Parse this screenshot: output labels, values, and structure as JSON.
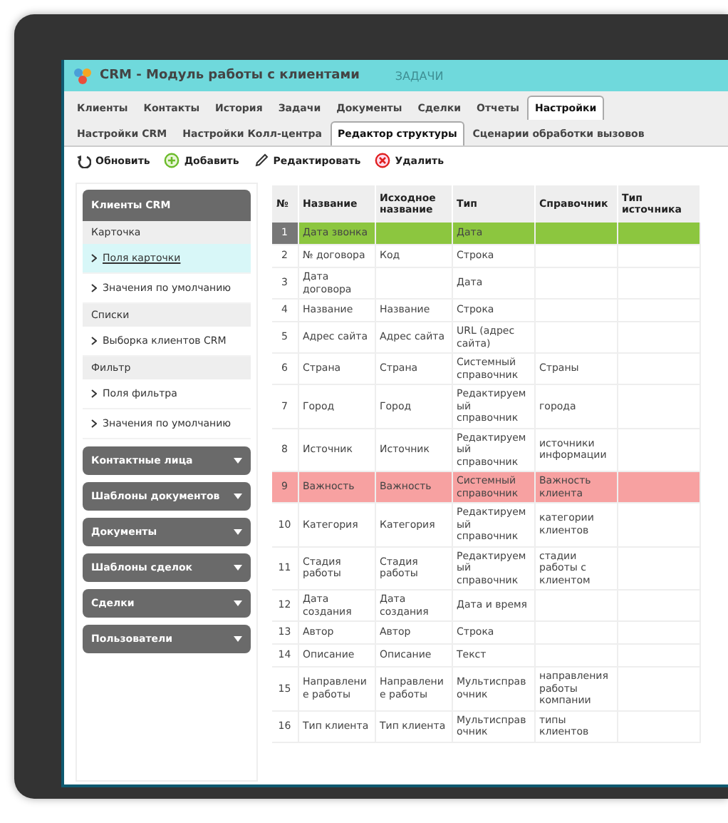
{
  "window": {
    "title": "CRM - Модуль работы с клиентами",
    "ghost_text": "ЗАДАЧИ"
  },
  "tabs": [
    {
      "label": "Клиенты",
      "selected": false
    },
    {
      "label": "Контакты",
      "selected": false
    },
    {
      "label": "История",
      "selected": false
    },
    {
      "label": "Задачи",
      "selected": false
    },
    {
      "label": "Документы",
      "selected": false
    },
    {
      "label": "Сделки",
      "selected": false
    },
    {
      "label": "Отчеты",
      "selected": false
    },
    {
      "label": "Настройки",
      "selected": true
    }
  ],
  "subtabs": [
    {
      "label": "Настройки CRM",
      "selected": false
    },
    {
      "label": "Настройки Колл-центра",
      "selected": false
    },
    {
      "label": "Редактор структуры",
      "selected": true
    },
    {
      "label": "Сценарии обработки вызовов",
      "selected": false
    }
  ],
  "toolbar": [
    {
      "kind": "refresh",
      "label": "Обновить"
    },
    {
      "kind": "add",
      "label": "Добавить"
    },
    {
      "kind": "edit",
      "label": "Редактировать"
    },
    {
      "kind": "delete",
      "label": "Удалить"
    }
  ],
  "sidebar": {
    "sections": [
      {
        "title": "Клиенты CRM",
        "expanded": true,
        "groups": [
          {
            "title": "Карточка",
            "items": [
              {
                "label": "Поля карточки",
                "selected": true
              },
              {
                "label": "Значения по умолчанию",
                "selected": false
              }
            ]
          },
          {
            "title": "Списки",
            "items": [
              {
                "label": "Выборка клиентов CRM",
                "selected": false
              }
            ]
          },
          {
            "title": "Фильтр",
            "items": [
              {
                "label": "Поля фильтра",
                "selected": false
              },
              {
                "label": "Значения по умолчанию",
                "selected": false
              }
            ]
          }
        ]
      },
      {
        "title": "Контактные лица",
        "expanded": false
      },
      {
        "title": "Шаблоны документов",
        "expanded": false
      },
      {
        "title": "Документы",
        "expanded": false
      },
      {
        "title": "Шаблоны сделок",
        "expanded": false
      },
      {
        "title": "Сделки",
        "expanded": false
      },
      {
        "title": "Пользователи",
        "expanded": false
      }
    ]
  },
  "table": {
    "columns": [
      "№",
      "Название",
      "Исходное название",
      "Тип",
      "Справочник",
      "Тип источника"
    ],
    "rows": [
      {
        "cells": [
          "1",
          "Дата звонка",
          "",
          "Дата",
          "",
          ""
        ],
        "selected": true,
        "color": "#8cc63f"
      },
      {
        "cells": [
          "2",
          "№ договора",
          "Код",
          "Строка",
          "",
          ""
        ],
        "selected": false
      },
      {
        "cells": [
          "3",
          "Дата договора",
          "",
          "Дата",
          "",
          ""
        ],
        "selected": false
      },
      {
        "cells": [
          "4",
          "Название",
          "Название",
          "Строка",
          "",
          ""
        ],
        "selected": false
      },
      {
        "cells": [
          "5",
          "Адрес сайта",
          "Адрес сайта",
          "URL (адрес сайта)",
          "",
          ""
        ],
        "selected": false
      },
      {
        "cells": [
          "6",
          "Страна",
          "Страна",
          "Системный справочник",
          "Страны",
          ""
        ],
        "selected": false
      },
      {
        "cells": [
          "7",
          "Город",
          "Город",
          "Редактируемый справочник",
          "города",
          ""
        ],
        "selected": false
      },
      {
        "cells": [
          "8",
          "Источник",
          "Источник",
          "Редактируемый справочник",
          "источники информации",
          ""
        ],
        "selected": false
      },
      {
        "cells": [
          "9",
          "Важность",
          "Важность",
          "Системный справочник",
          "Важность клиента",
          ""
        ],
        "selected": false,
        "color": "#f7a1a1"
      },
      {
        "cells": [
          "10",
          "Категория",
          "Категория",
          "Редактируемый справочник",
          "категории клиентов",
          ""
        ],
        "selected": false
      },
      {
        "cells": [
          "11",
          "Стадия работы",
          "Стадия работы",
          "Редактируемый справочник",
          "стадии работы с клиентом",
          ""
        ],
        "selected": false
      },
      {
        "cells": [
          "12",
          "Дата создания",
          "Дата создания",
          "Дата и время",
          "",
          ""
        ],
        "selected": false
      },
      {
        "cells": [
          "13",
          "Автор",
          "Автор",
          "Строка",
          "",
          ""
        ],
        "selected": false
      },
      {
        "cells": [
          "14",
          "Описание",
          "Описание",
          "Текст",
          "",
          ""
        ],
        "selected": false
      },
      {
        "cells": [
          "15",
          "Направление работы",
          "Направление работы",
          "Мультисправочник",
          "направления работы компании",
          ""
        ],
        "selected": false
      },
      {
        "cells": [
          "16",
          "Тип клиента",
          "Тип клиента",
          "Мультисправочник",
          "типы клиентов",
          ""
        ],
        "selected": false
      }
    ]
  }
}
